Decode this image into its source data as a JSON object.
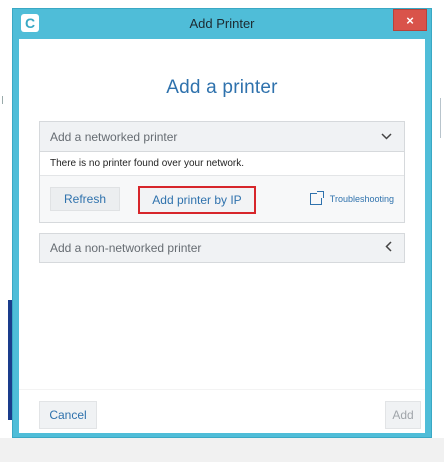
{
  "window": {
    "title": "Add Printer",
    "app_icon_letter": "C",
    "close_label": "×"
  },
  "heading": "Add a printer",
  "networked_section": {
    "label": "Add a networked printer",
    "chevron_icon": "chevron-down-icon",
    "message": "There is no printer found over your network.",
    "refresh_label": "Refresh",
    "add_by_ip_label": "Add printer by IP",
    "troubleshooting_label": "Troubleshooting",
    "troubleshooting_icon": "external-link-icon"
  },
  "non_networked_section": {
    "label": "Add a non-networked printer",
    "chevron_icon": "chevron-left-icon"
  },
  "footer": {
    "cancel_label": "Cancel",
    "add_label": "Add"
  },
  "colors": {
    "titlebar": "#4fbdd8",
    "accent_text": "#2f72ad",
    "highlight_box": "#d7262b",
    "close_button": "#d9534a"
  }
}
